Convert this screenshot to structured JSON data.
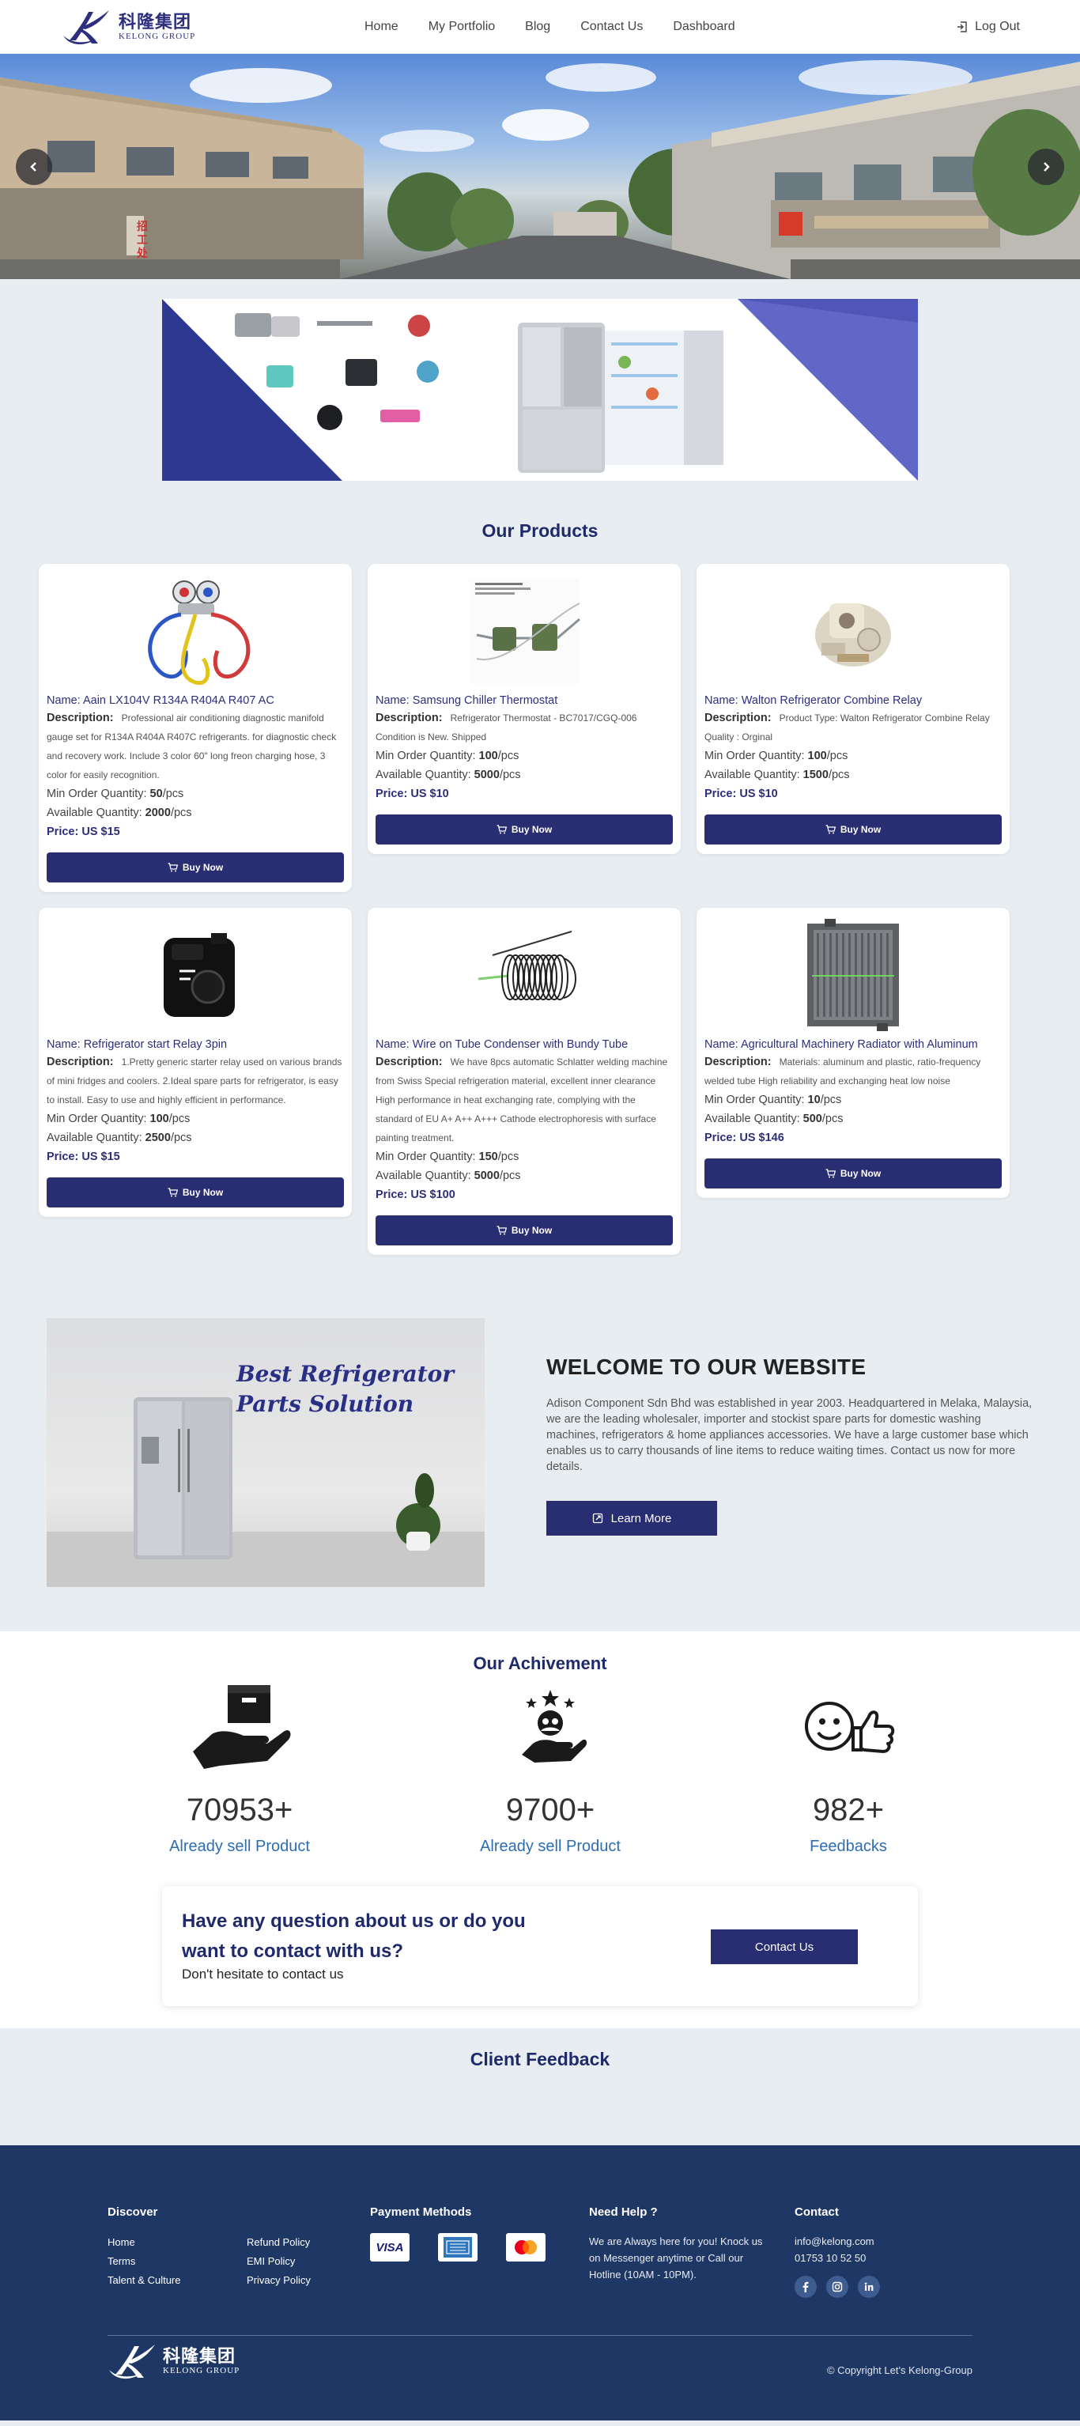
{
  "brand": {
    "name_cn": "科隆集团",
    "name_en": "KELONG GROUP"
  },
  "nav": {
    "links": [
      "Home",
      "My Portfolio",
      "Blog",
      "Contact Us",
      "Dashboard"
    ],
    "logout": "Log Out"
  },
  "hero": {
    "prev_icon": "chevron-left-icon",
    "next_icon": "chevron-right-icon",
    "sign_text": "招工处"
  },
  "products_section": {
    "title": "Our Products",
    "name_prefix": "Name:",
    "desc_prefix": "Description:",
    "moq_prefix": "Min Order Quantity:",
    "avail_prefix": "Available Quantity:",
    "price_prefix": "Price:",
    "unit": "/pcs",
    "buy_label": "Buy Now",
    "items": [
      {
        "name": "Aain LX104V R134A R404A R407 AC",
        "description": "Professional air conditioning diagnostic manifold gauge set for R134A R404A R407C refrigerants. for diagnostic check and recovery work. Include 3 color 60\" long freon charging hose, 3 color for easily recognition.",
        "moq": "50",
        "available": "2000",
        "price": "US $15",
        "image": "manifold-gauge"
      },
      {
        "name": "Samsung Chiller Thermostat",
        "description": "Refrigerator Thermostat - BC7017/CGQ-006 Condition is New. Shipped",
        "moq": "100",
        "available": "5000",
        "price": "US $10",
        "image": "thermostat"
      },
      {
        "name": "Walton Refrigerator Combine Relay",
        "description": "Product Type: Walton Refrigerator Combine Relay Quality : Orginal",
        "moq": "100",
        "available": "1500",
        "price": "US $10",
        "image": "relay"
      },
      {
        "name": "Refrigerator start Relay 3pin",
        "description": "1.Pretty generic starter relay used on various brands of mini fridges and coolers. 2.Ideal spare parts for refrigerator, is easy to install. Easy to use and highly efficient in performance.",
        "moq": "100",
        "available": "2500",
        "price": "US $15",
        "image": "start-relay"
      },
      {
        "name": "Wire on Tube Condenser with Bundy Tube",
        "description": "We have 8pcs automatic Schlatter welding machine from Swiss Special refrigeration material, excellent inner clearance High performance in heat exchanging rate, complying with the standard of EU A+ A++ A+++ Cathode electrophoresis with surface painting treatment.",
        "moq": "150",
        "available": "5000",
        "price": "US $100",
        "image": "condenser"
      },
      {
        "name": "Agricultural Machinery Radiator with Aluminum",
        "description": "Materials: aluminum and plastic, ratio-frequency welded tube High reliability and exchanging heat low noise",
        "moq": "10",
        "available": "500",
        "price": "US $146",
        "image": "radiator"
      }
    ]
  },
  "welcome": {
    "image_text": "Best Refrigerator Parts Solution",
    "title": "WELCOME TO OUR WEBSITE",
    "body": "Adison Component Sdn Bhd was established in year 2003. Headquartered in Melaka, Malaysia, we are the leading wholesaler, importer and stockist spare parts for domestic washing machines, refrigerators & home appliances accessories. We have a large customer base which enables us to carry thousands of line items to reduce waiting times. Contact us now for more details.",
    "button": "Learn More"
  },
  "achievement": {
    "title": "Our Achivement",
    "stats": [
      {
        "number": "70953",
        "suffix": "+",
        "label": "Already sell Product",
        "icon": "hand-box-icon"
      },
      {
        "number": "9700",
        "suffix": "+",
        "label": "Already sell Product",
        "icon": "hand-people-stars-icon"
      },
      {
        "number": "982",
        "suffix": "+",
        "label": "Feedbacks",
        "icon": "smile-thumbs-up-icon"
      }
    ]
  },
  "contact_cta": {
    "question": "Have any question about us or do you want to contact with us?",
    "sub": "Don't hesitate to contact us",
    "button": "Contact Us"
  },
  "feedback": {
    "title": "Client Feedback"
  },
  "footer": {
    "discover": {
      "title": "Discover",
      "col1": [
        "Home",
        "Terms",
        "Talent & Culture"
      ],
      "col2": [
        "Refund Policy",
        "EMI Policy",
        "Privacy Policy"
      ]
    },
    "payment": {
      "title": "Payment Methods",
      "cards": [
        "VISA",
        "AMEX",
        "Mastercard"
      ]
    },
    "help": {
      "title": "Need Help ?",
      "text": "We are Always here for you! Knock us on Messenger anytime or Call our Hotline (10AM - 10PM)."
    },
    "contact": {
      "title": "Contact",
      "email": "info@kelong.com",
      "phone": "01753 10 52 50",
      "socials": [
        "facebook-icon",
        "instagram-icon",
        "linkedin-icon"
      ]
    },
    "copyright": "© Copyright Let's Kelong-Group"
  },
  "colors": {
    "primary": "#292d72",
    "heading": "#1f2a6b",
    "footer_bg": "#1f3764",
    "page_bg": "#e8edf2",
    "stat_label": "#2d6db0"
  }
}
